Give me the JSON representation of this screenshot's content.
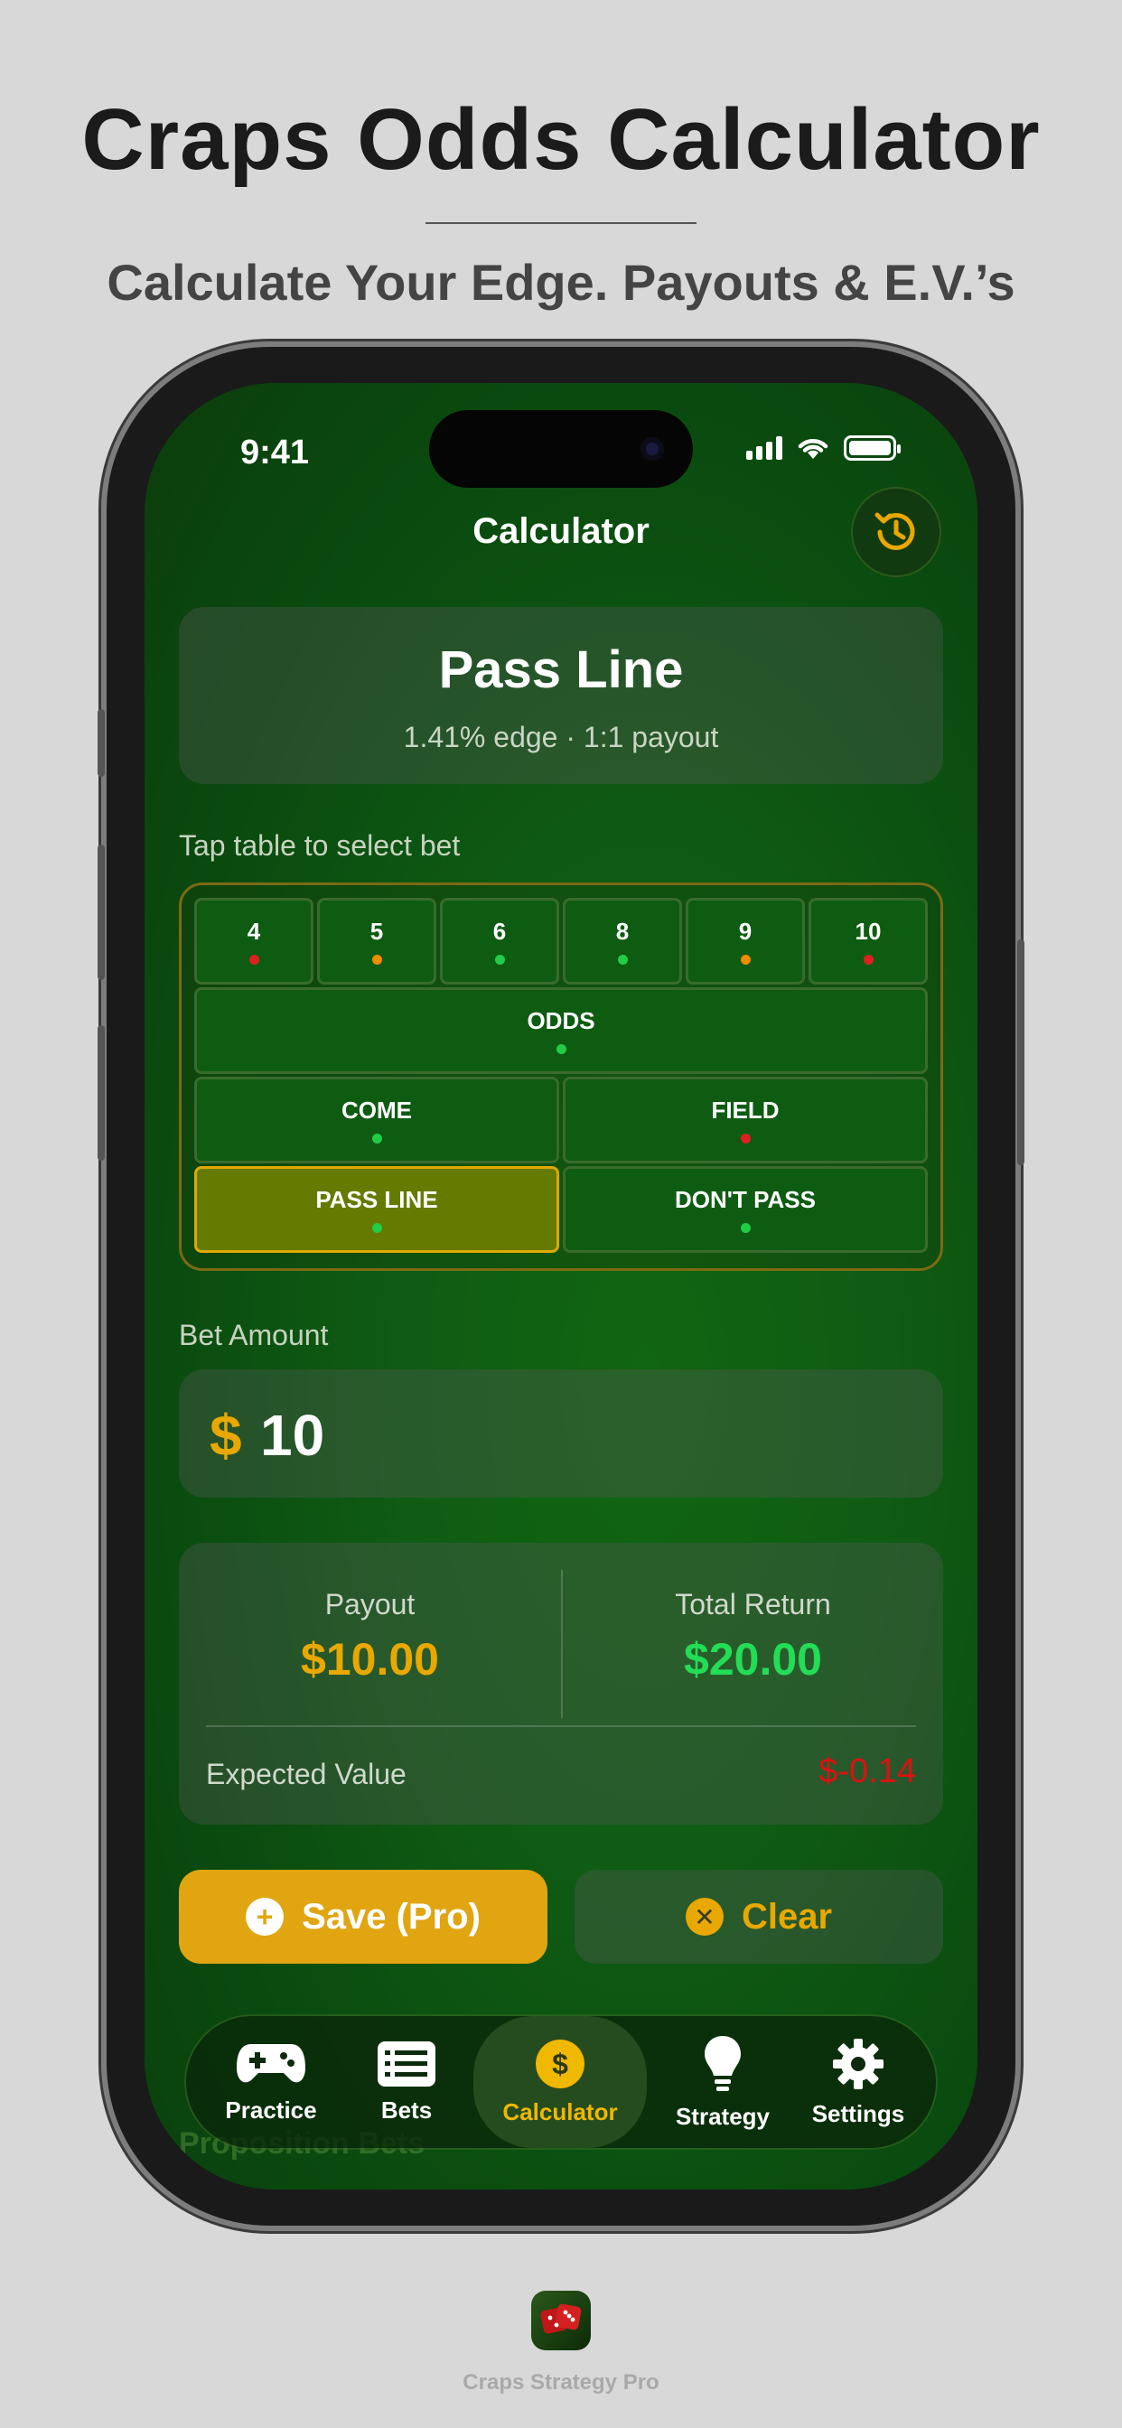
{
  "marketing": {
    "headline": "Craps Odds Calculator",
    "subhead": "Calculate Your Edge. Payouts & E.V.’s",
    "app_name": "Craps Strategy Pro"
  },
  "status_bar": {
    "time": "9:41"
  },
  "nav": {
    "title": "Calculator",
    "history_icon": "history-clock-icon"
  },
  "selected_bet": {
    "name": "Pass Line",
    "subtitle": "1.41% edge · 1:1 payout"
  },
  "table": {
    "hint": "Tap table to select bet",
    "numbers": [
      {
        "label": "4",
        "dot_color": "#e02020"
      },
      {
        "label": "5",
        "dot_color": "#f08a00"
      },
      {
        "label": "6",
        "dot_color": "#22cc44"
      },
      {
        "label": "8",
        "dot_color": "#22cc44"
      },
      {
        "label": "9",
        "dot_color": "#f08a00"
      },
      {
        "label": "10",
        "dot_color": "#e02020"
      }
    ],
    "odds": {
      "label": "ODDS",
      "dot_color": "#22cc44"
    },
    "come": {
      "label": "COME",
      "dot_color": "#22cc44"
    },
    "field": {
      "label": "FIELD",
      "dot_color": "#e02020"
    },
    "pass_line": {
      "label": "PASS LINE",
      "dot_color": "#22cc44",
      "selected": true
    },
    "dont_pass": {
      "label": "DON'T PASS",
      "dot_color": "#22cc44"
    }
  },
  "bet_amount": {
    "label": "Bet Amount",
    "currency": "$",
    "value": "10"
  },
  "results": {
    "payout_label": "Payout",
    "payout_value": "$10.00",
    "total_return_label": "Total Return",
    "total_return_value": "$20.00",
    "ev_label": "Expected Value",
    "ev_value": "$-0.14"
  },
  "actions": {
    "save_label": "Save (Pro)",
    "clear_label": "Clear"
  },
  "peek_section": {
    "title": "Proposition Bets"
  },
  "tabs": [
    {
      "label": "Practice",
      "icon": "gamepad-icon"
    },
    {
      "label": "Bets",
      "icon": "list-icon"
    },
    {
      "label": "Calculator",
      "icon": "dollar-coin-icon",
      "active": true
    },
    {
      "label": "Strategy",
      "icon": "lightbulb-icon"
    },
    {
      "label": "Settings",
      "icon": "gear-icon"
    }
  ],
  "colors": {
    "accent_gold": "#e0a510",
    "positive_green": "#22dd55",
    "negative_red": "#e01010",
    "felt_green": "#0f5c14"
  }
}
